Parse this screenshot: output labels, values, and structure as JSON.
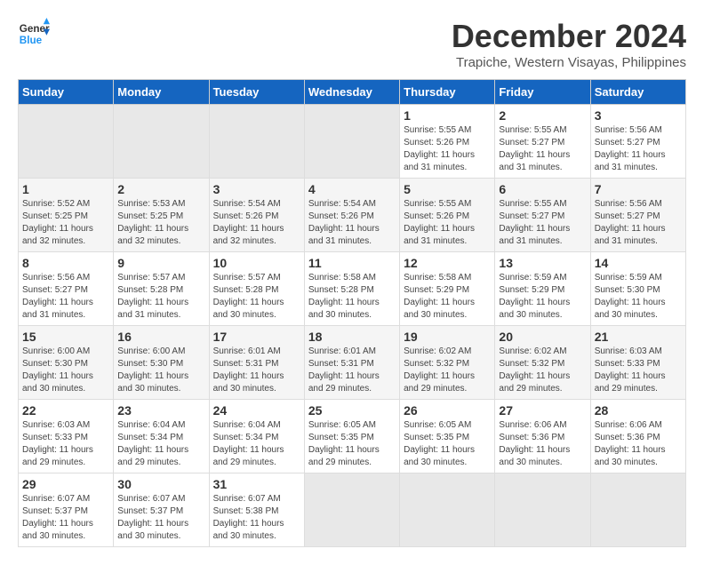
{
  "header": {
    "logo_line1": "General",
    "logo_line2": "Blue",
    "month": "December 2024",
    "location": "Trapiche, Western Visayas, Philippines"
  },
  "calendar": {
    "weekdays": [
      "Sunday",
      "Monday",
      "Tuesday",
      "Wednesday",
      "Thursday",
      "Friday",
      "Saturday"
    ],
    "weeks": [
      [
        {
          "day": "",
          "empty": true
        },
        {
          "day": "",
          "empty": true
        },
        {
          "day": "",
          "empty": true
        },
        {
          "day": "",
          "empty": true
        },
        {
          "day": "1",
          "sunrise": "Sunrise: 5:55 AM",
          "sunset": "Sunset: 5:26 PM",
          "daylight": "Daylight: 11 hours and 31 minutes."
        },
        {
          "day": "2",
          "sunrise": "Sunrise: 5:55 AM",
          "sunset": "Sunset: 5:27 PM",
          "daylight": "Daylight: 11 hours and 31 minutes."
        },
        {
          "day": "3",
          "sunrise": "Sunrise: 5:56 AM",
          "sunset": "Sunset: 5:27 PM",
          "daylight": "Daylight: 11 hours and 31 minutes."
        }
      ],
      [
        {
          "day": "1",
          "sunrise": "Sunrise: 5:52 AM",
          "sunset": "Sunset: 5:25 PM",
          "daylight": "Daylight: 11 hours and 32 minutes."
        },
        {
          "day": "2",
          "sunrise": "Sunrise: 5:53 AM",
          "sunset": "Sunset: 5:25 PM",
          "daylight": "Daylight: 11 hours and 32 minutes."
        },
        {
          "day": "3",
          "sunrise": "Sunrise: 5:54 AM",
          "sunset": "Sunset: 5:26 PM",
          "daylight": "Daylight: 11 hours and 32 minutes."
        },
        {
          "day": "4",
          "sunrise": "Sunrise: 5:54 AM",
          "sunset": "Sunset: 5:26 PM",
          "daylight": "Daylight: 11 hours and 31 minutes."
        },
        {
          "day": "5",
          "sunrise": "Sunrise: 5:55 AM",
          "sunset": "Sunset: 5:26 PM",
          "daylight": "Daylight: 11 hours and 31 minutes."
        },
        {
          "day": "6",
          "sunrise": "Sunrise: 5:55 AM",
          "sunset": "Sunset: 5:27 PM",
          "daylight": "Daylight: 11 hours and 31 minutes."
        },
        {
          "day": "7",
          "sunrise": "Sunrise: 5:56 AM",
          "sunset": "Sunset: 5:27 PM",
          "daylight": "Daylight: 11 hours and 31 minutes."
        }
      ],
      [
        {
          "day": "8",
          "sunrise": "Sunrise: 5:56 AM",
          "sunset": "Sunset: 5:27 PM",
          "daylight": "Daylight: 11 hours and 31 minutes."
        },
        {
          "day": "9",
          "sunrise": "Sunrise: 5:57 AM",
          "sunset": "Sunset: 5:28 PM",
          "daylight": "Daylight: 11 hours and 31 minutes."
        },
        {
          "day": "10",
          "sunrise": "Sunrise: 5:57 AM",
          "sunset": "Sunset: 5:28 PM",
          "daylight": "Daylight: 11 hours and 30 minutes."
        },
        {
          "day": "11",
          "sunrise": "Sunrise: 5:58 AM",
          "sunset": "Sunset: 5:28 PM",
          "daylight": "Daylight: 11 hours and 30 minutes."
        },
        {
          "day": "12",
          "sunrise": "Sunrise: 5:58 AM",
          "sunset": "Sunset: 5:29 PM",
          "daylight": "Daylight: 11 hours and 30 minutes."
        },
        {
          "day": "13",
          "sunrise": "Sunrise: 5:59 AM",
          "sunset": "Sunset: 5:29 PM",
          "daylight": "Daylight: 11 hours and 30 minutes."
        },
        {
          "day": "14",
          "sunrise": "Sunrise: 5:59 AM",
          "sunset": "Sunset: 5:30 PM",
          "daylight": "Daylight: 11 hours and 30 minutes."
        }
      ],
      [
        {
          "day": "15",
          "sunrise": "Sunrise: 6:00 AM",
          "sunset": "Sunset: 5:30 PM",
          "daylight": "Daylight: 11 hours and 30 minutes."
        },
        {
          "day": "16",
          "sunrise": "Sunrise: 6:00 AM",
          "sunset": "Sunset: 5:30 PM",
          "daylight": "Daylight: 11 hours and 30 minutes."
        },
        {
          "day": "17",
          "sunrise": "Sunrise: 6:01 AM",
          "sunset": "Sunset: 5:31 PM",
          "daylight": "Daylight: 11 hours and 30 minutes."
        },
        {
          "day": "18",
          "sunrise": "Sunrise: 6:01 AM",
          "sunset": "Sunset: 5:31 PM",
          "daylight": "Daylight: 11 hours and 29 minutes."
        },
        {
          "day": "19",
          "sunrise": "Sunrise: 6:02 AM",
          "sunset": "Sunset: 5:32 PM",
          "daylight": "Daylight: 11 hours and 29 minutes."
        },
        {
          "day": "20",
          "sunrise": "Sunrise: 6:02 AM",
          "sunset": "Sunset: 5:32 PM",
          "daylight": "Daylight: 11 hours and 29 minutes."
        },
        {
          "day": "21",
          "sunrise": "Sunrise: 6:03 AM",
          "sunset": "Sunset: 5:33 PM",
          "daylight": "Daylight: 11 hours and 29 minutes."
        }
      ],
      [
        {
          "day": "22",
          "sunrise": "Sunrise: 6:03 AM",
          "sunset": "Sunset: 5:33 PM",
          "daylight": "Daylight: 11 hours and 29 minutes."
        },
        {
          "day": "23",
          "sunrise": "Sunrise: 6:04 AM",
          "sunset": "Sunset: 5:34 PM",
          "daylight": "Daylight: 11 hours and 29 minutes."
        },
        {
          "day": "24",
          "sunrise": "Sunrise: 6:04 AM",
          "sunset": "Sunset: 5:34 PM",
          "daylight": "Daylight: 11 hours and 29 minutes."
        },
        {
          "day": "25",
          "sunrise": "Sunrise: 6:05 AM",
          "sunset": "Sunset: 5:35 PM",
          "daylight": "Daylight: 11 hours and 29 minutes."
        },
        {
          "day": "26",
          "sunrise": "Sunrise: 6:05 AM",
          "sunset": "Sunset: 5:35 PM",
          "daylight": "Daylight: 11 hours and 30 minutes."
        },
        {
          "day": "27",
          "sunrise": "Sunrise: 6:06 AM",
          "sunset": "Sunset: 5:36 PM",
          "daylight": "Daylight: 11 hours and 30 minutes."
        },
        {
          "day": "28",
          "sunrise": "Sunrise: 6:06 AM",
          "sunset": "Sunset: 5:36 PM",
          "daylight": "Daylight: 11 hours and 30 minutes."
        }
      ],
      [
        {
          "day": "29",
          "sunrise": "Sunrise: 6:07 AM",
          "sunset": "Sunset: 5:37 PM",
          "daylight": "Daylight: 11 hours and 30 minutes."
        },
        {
          "day": "30",
          "sunrise": "Sunrise: 6:07 AM",
          "sunset": "Sunset: 5:37 PM",
          "daylight": "Daylight: 11 hours and 30 minutes."
        },
        {
          "day": "31",
          "sunrise": "Sunrise: 6:07 AM",
          "sunset": "Sunset: 5:38 PM",
          "daylight": "Daylight: 11 hours and 30 minutes."
        },
        {
          "day": "",
          "empty": true
        },
        {
          "day": "",
          "empty": true
        },
        {
          "day": "",
          "empty": true
        },
        {
          "day": "",
          "empty": true
        }
      ]
    ]
  }
}
